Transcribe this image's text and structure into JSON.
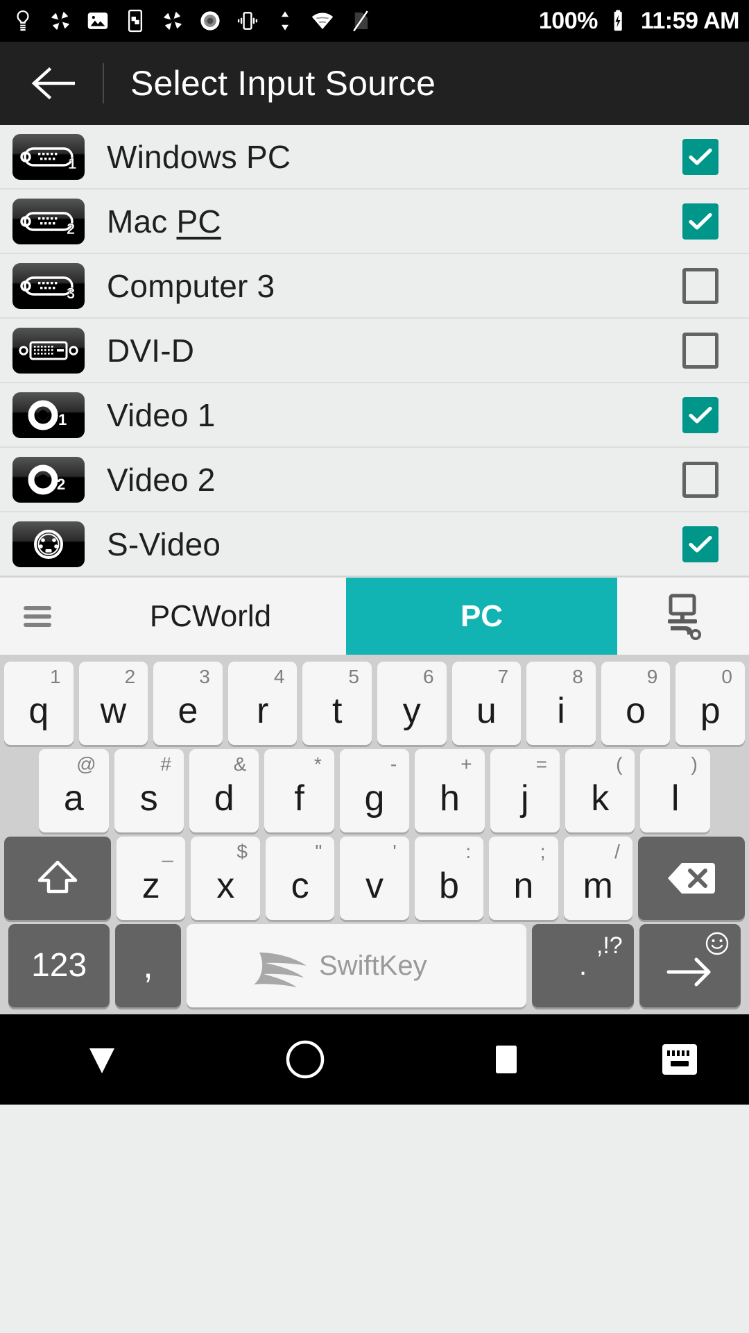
{
  "status_bar": {
    "icons": [
      {
        "name": "lightbulb-icon"
      },
      {
        "name": "pinwheel-icon"
      },
      {
        "name": "image-icon"
      },
      {
        "name": "screen-pin-icon"
      },
      {
        "name": "pinwheel-icon-2"
      },
      {
        "name": "record-icon"
      },
      {
        "name": "vibrate-icon"
      },
      {
        "name": "data-transfer-icon"
      },
      {
        "name": "wifi-icon"
      },
      {
        "name": "no-sim-icon"
      }
    ],
    "battery_percent": "100%",
    "battery_icon": "battery-charging-icon",
    "clock": "11:59 AM"
  },
  "app_bar": {
    "back_icon": "back-arrow-icon",
    "title": "Select Input Source"
  },
  "input_sources": [
    {
      "label": "Windows PC",
      "icon": "vga-connector-1-icon",
      "checked": true
    },
    {
      "label": "Mac ",
      "label_suggestion": "PC",
      "icon": "vga-connector-2-icon",
      "checked": true
    },
    {
      "label": "Computer 3",
      "icon": "vga-connector-3-icon",
      "checked": false
    },
    {
      "label": "DVI-D",
      "icon": "dvi-connector-icon",
      "checked": false
    },
    {
      "label": "Video 1",
      "icon": "composite-video-1-icon",
      "checked": true
    },
    {
      "label": "Video 2",
      "icon": "composite-video-2-icon",
      "checked": false
    },
    {
      "label": "S-Video",
      "icon": "s-video-connector-icon",
      "checked": true
    }
  ],
  "suggestion_bar": {
    "menu_icon": "hamburger-menu-icon",
    "suggestions": [
      {
        "text": "PCWorld",
        "active": false
      },
      {
        "text": "PC",
        "active": true
      }
    ],
    "right_icon": "desktop-computer-icon"
  },
  "keyboard": {
    "brand": "SwiftKey",
    "row1": [
      {
        "main": "q",
        "alt": "1"
      },
      {
        "main": "w",
        "alt": "2"
      },
      {
        "main": "e",
        "alt": "3"
      },
      {
        "main": "r",
        "alt": "4"
      },
      {
        "main": "t",
        "alt": "5"
      },
      {
        "main": "y",
        "alt": "6"
      },
      {
        "main": "u",
        "alt": "7"
      },
      {
        "main": "i",
        "alt": "8"
      },
      {
        "main": "o",
        "alt": "9"
      },
      {
        "main": "p",
        "alt": "0"
      }
    ],
    "row2": [
      {
        "main": "a",
        "alt": "@"
      },
      {
        "main": "s",
        "alt": "#"
      },
      {
        "main": "d",
        "alt": "&"
      },
      {
        "main": "f",
        "alt": "*"
      },
      {
        "main": "g",
        "alt": "-"
      },
      {
        "main": "h",
        "alt": "+"
      },
      {
        "main": "j",
        "alt": "="
      },
      {
        "main": "k",
        "alt": "("
      },
      {
        "main": "l",
        "alt": ")"
      }
    ],
    "row3": [
      {
        "main": "z",
        "alt": "_"
      },
      {
        "main": "x",
        "alt": "$"
      },
      {
        "main": "c",
        "alt": "\""
      },
      {
        "main": "v",
        "alt": "'"
      },
      {
        "main": "b",
        "alt": ":"
      },
      {
        "main": "n",
        "alt": ";"
      },
      {
        "main": "m",
        "alt": "/"
      }
    ],
    "shift_icon": "shift-arrow-icon",
    "backspace_icon": "backspace-icon",
    "numbers_key": "123",
    "comma_key": ",",
    "punct_main": ".",
    "punct_alt": ",!?",
    "enter_icon": "enter-arrow-icon",
    "emoji_icon": "smiley-icon"
  },
  "nav_bar": {
    "back_icon": "nav-hide-keyboard-icon",
    "home_icon": "nav-home-icon",
    "recents_icon": "nav-recents-icon",
    "keyboard_icon": "nav-keyboard-switch-icon"
  },
  "colors": {
    "accent_teal": "#00968a",
    "suggestion_teal": "#12b3b3",
    "appbar_dark": "#212121",
    "list_bg": "#eceded",
    "keyboard_bg": "#cfcfcf",
    "key_light": "#f6f6f6",
    "key_dark": "#636363"
  }
}
